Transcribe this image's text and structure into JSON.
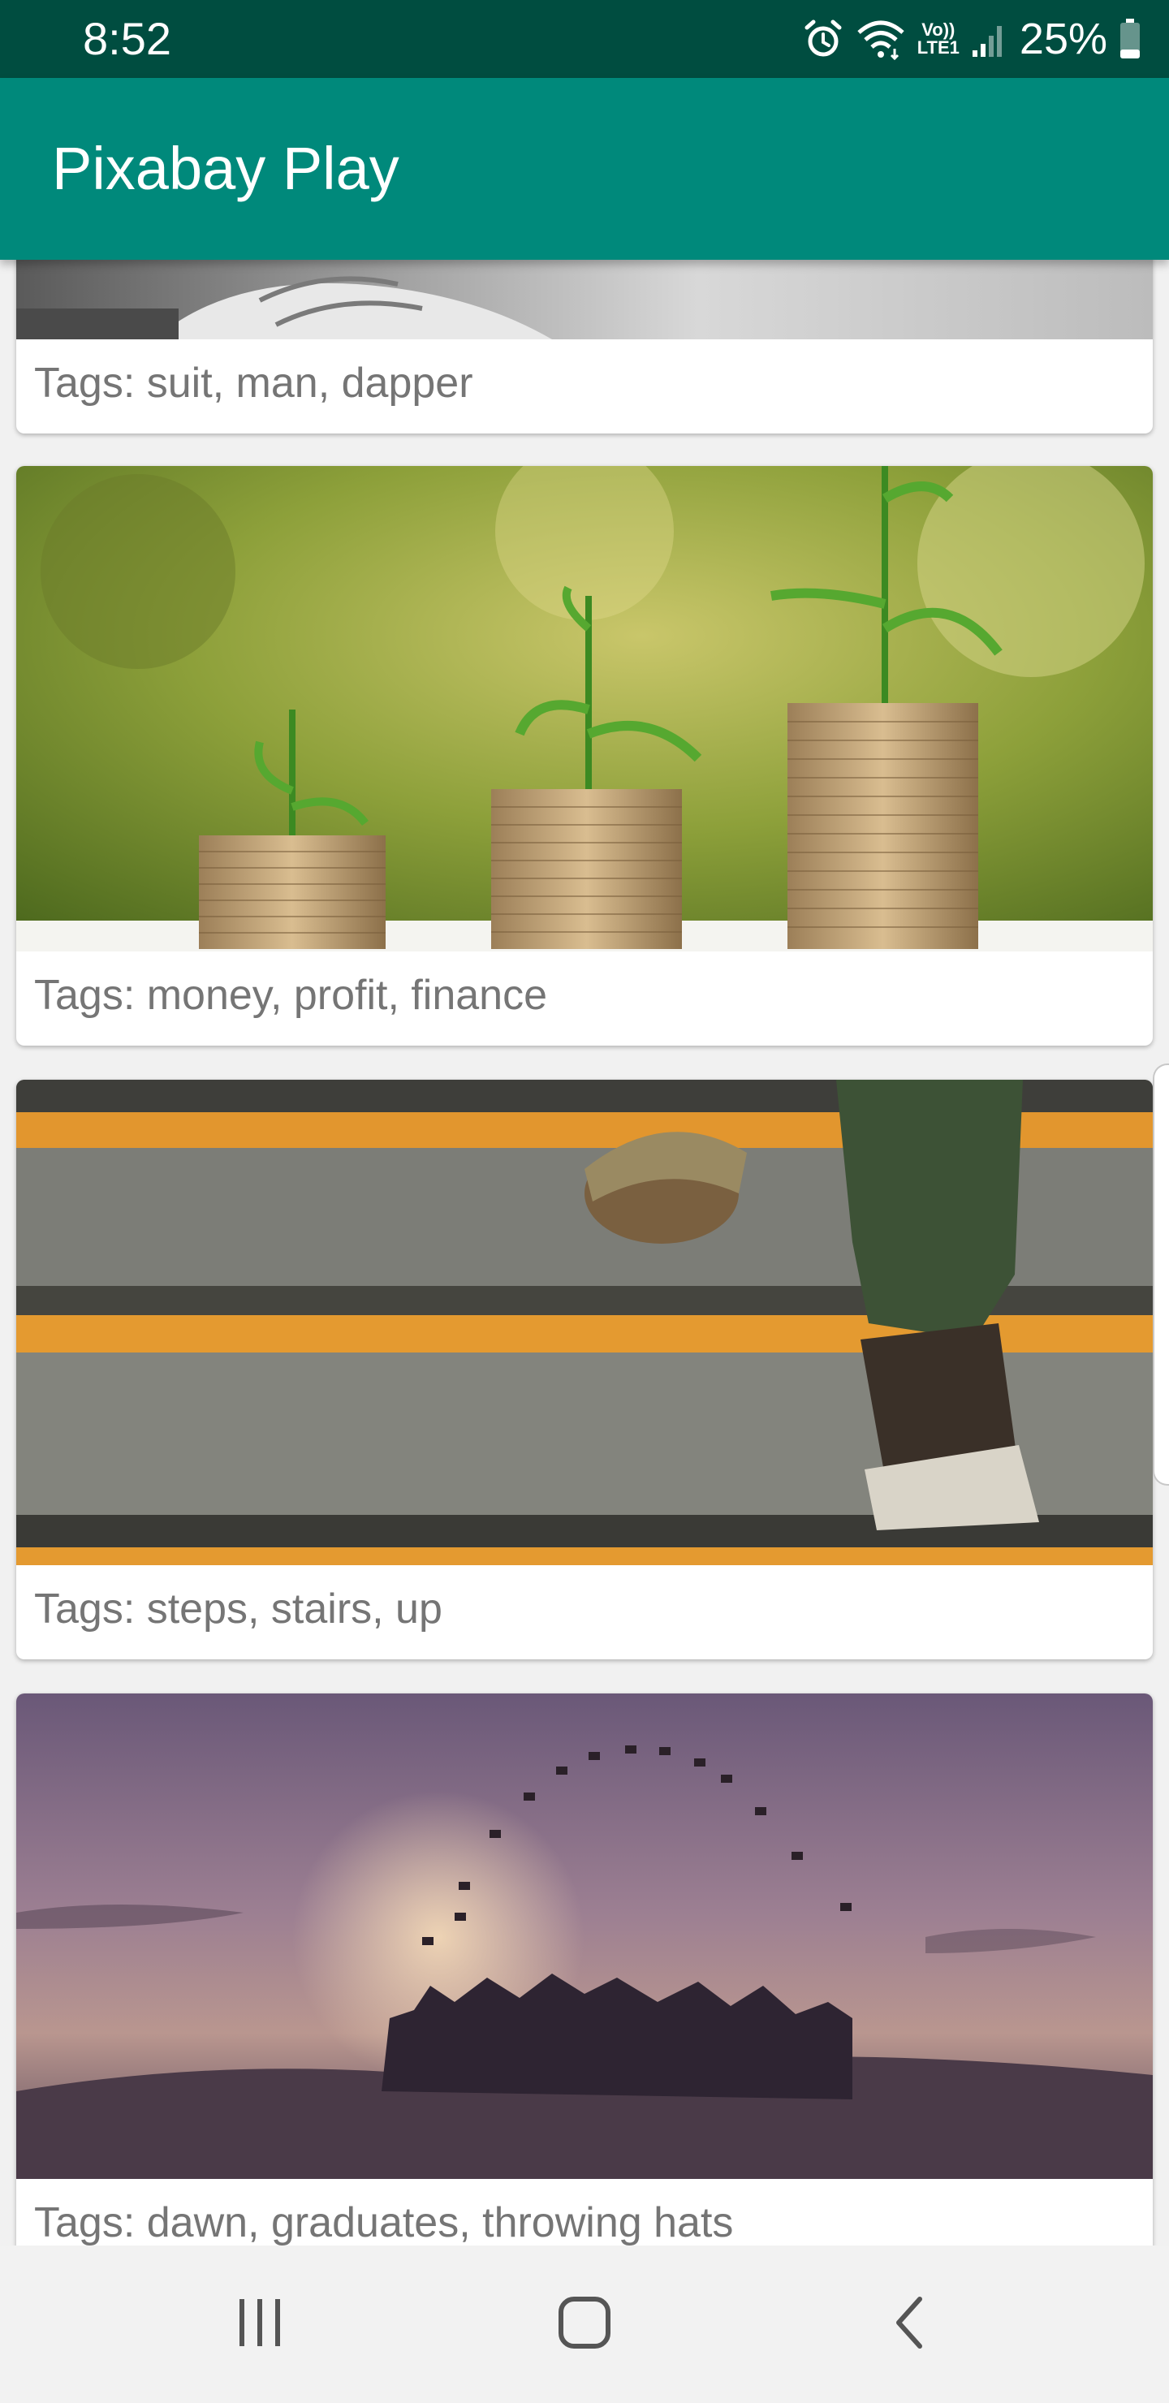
{
  "status_bar": {
    "time": "8:52",
    "battery_percent": "25%",
    "network_label_top": "Vo))",
    "network_label_bottom": "LTE1",
    "icons": [
      "alarm-icon",
      "wifi-icon",
      "volte-icon",
      "signal-icon",
      "battery-icon"
    ],
    "battery_level": 0.25
  },
  "app_bar": {
    "title": "Pixabay Play",
    "color": "#00897b",
    "status_color": "#004d40"
  },
  "feed": {
    "cards": [
      {
        "tags": "Tags: suit, man, dapper"
      },
      {
        "tags": "Tags: money, profit, finance"
      },
      {
        "tags": "Tags: steps, stairs, up"
      },
      {
        "tags": "Tags: dawn, graduates, throwing hats"
      }
    ]
  },
  "nav_bar": {
    "recents": "recents-icon",
    "home": "home-icon",
    "back": "back-icon"
  }
}
